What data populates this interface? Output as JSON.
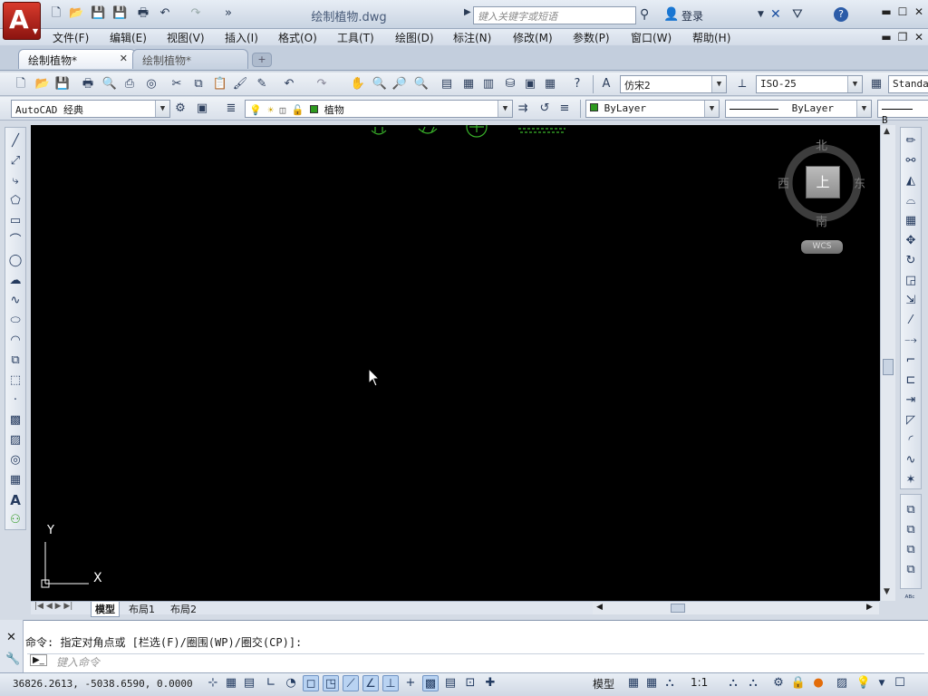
{
  "title_bar": {
    "document_title": "绘制植物.dwg",
    "search_placeholder": "键入关键字或短语",
    "login_label": "登录"
  },
  "menu": {
    "items": [
      "文件(F)",
      "编辑(E)",
      "视图(V)",
      "插入(I)",
      "格式(O)",
      "工具(T)",
      "绘图(D)",
      "标注(N)",
      "修改(M)",
      "参数(P)",
      "窗口(W)",
      "帮助(H)"
    ]
  },
  "doc_tabs": [
    {
      "label": "绘制植物*",
      "active": true
    },
    {
      "label": "绘制植物*",
      "active": false
    }
  ],
  "toolbar_styles": {
    "text_style": "仿宋2",
    "dim_style": "ISO-25",
    "table_style": "Standa"
  },
  "toolbar_layers": {
    "workspace": "AutoCAD 经典",
    "layer": "植物",
    "color": "ByLayer",
    "linetype": "ByLayer",
    "lineweight_partial": "B"
  },
  "viewcube": {
    "top_label": "上",
    "north": "北",
    "south": "南",
    "east": "东",
    "west": "西",
    "wcs_label": "WCS"
  },
  "ucs": {
    "x_label": "X",
    "y_label": "Y"
  },
  "layout_tabs": [
    "模型",
    "布局1",
    "布局2"
  ],
  "command": {
    "history": "命令: 指定对角点或 [栏选(F)/圈围(WP)/圈交(CP)]:",
    "input_placeholder": "键入命令"
  },
  "status": {
    "coordinates": "36826.2613, -5038.6590, 0.0000",
    "model_label": "模型",
    "scale": "1:1"
  },
  "colors": {
    "canvas_bg": "#000000",
    "plant_green": "#39b22a",
    "layer_swatch": "#2e9a1f"
  }
}
